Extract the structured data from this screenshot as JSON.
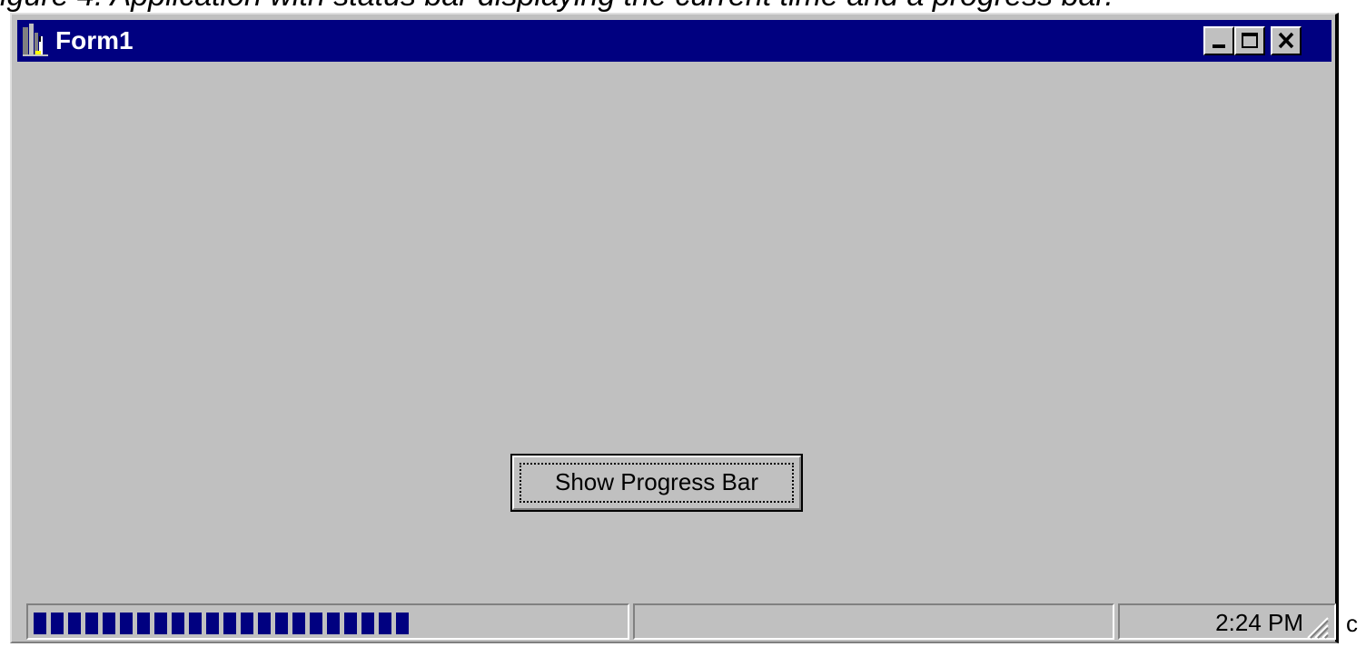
{
  "clip": {
    "top_text": "igure 4: Application with status bar displaying the current time and a progress bar.",
    "right_text": "c"
  },
  "window": {
    "title": "Form1",
    "icons": {
      "app": "app-icon",
      "minimize": "minimize-icon",
      "maximize": "maximize-icon",
      "close": "close-icon"
    }
  },
  "main": {
    "show_button_label": "Show Progress Bar"
  },
  "statusbar": {
    "progress": {
      "filled_blocks": 22,
      "fraction": 0.68
    },
    "middle_text": "",
    "time": "2:24 PM",
    "grip_icon": "size-grip-icon"
  },
  "colors": {
    "titlebar": "#000080",
    "face": "#c0c0c0",
    "progress": "#000080"
  }
}
